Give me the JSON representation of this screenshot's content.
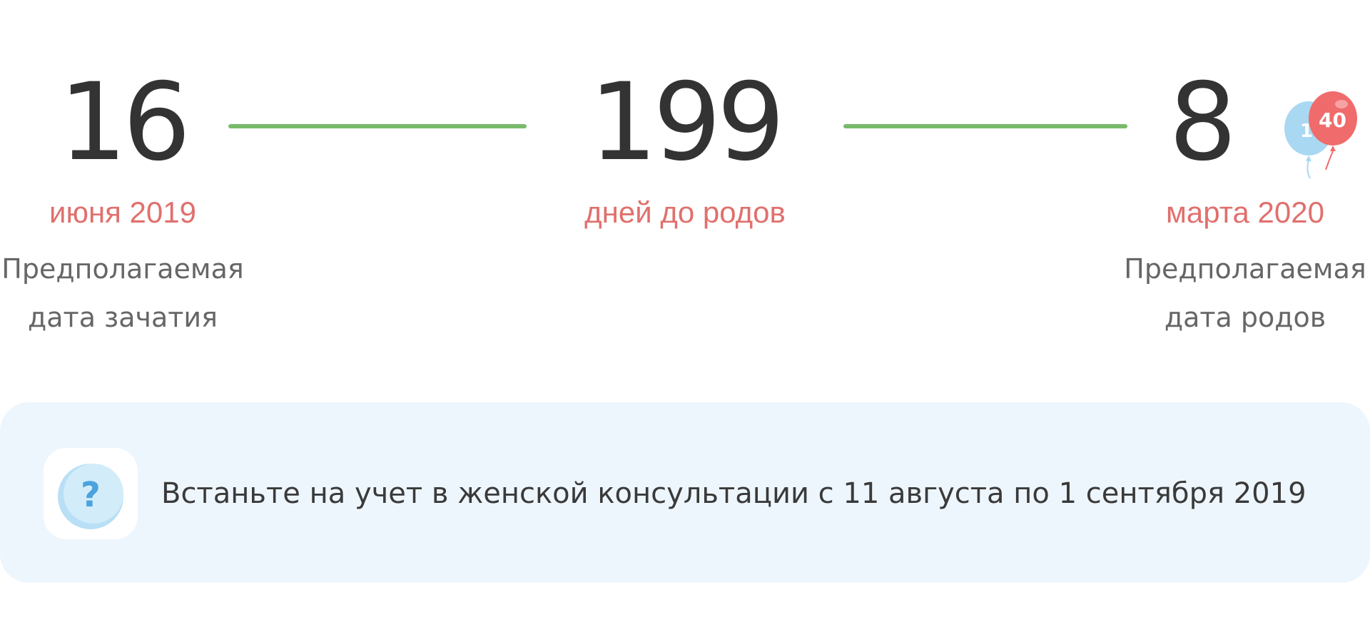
{
  "timeline": {
    "start": {
      "number": "16",
      "date": "июня 2019",
      "caption_line1": "Предполагаемая",
      "caption_line2": "дата зачатия"
    },
    "middle": {
      "number": "199",
      "label": "дней до родов"
    },
    "end": {
      "number": "8",
      "date": "марта 2020",
      "caption_line1": "Предполагаемая",
      "caption_line2": "дата родов",
      "balloon_label": "40"
    },
    "connector_color": "#78bb6b",
    "date_color": "#e0706d"
  },
  "notice": {
    "icon": "question-icon",
    "text": "Встаньте на учет в женской консультации с 11 августа по 1 сентября 2019",
    "background": "#eef6fd"
  }
}
